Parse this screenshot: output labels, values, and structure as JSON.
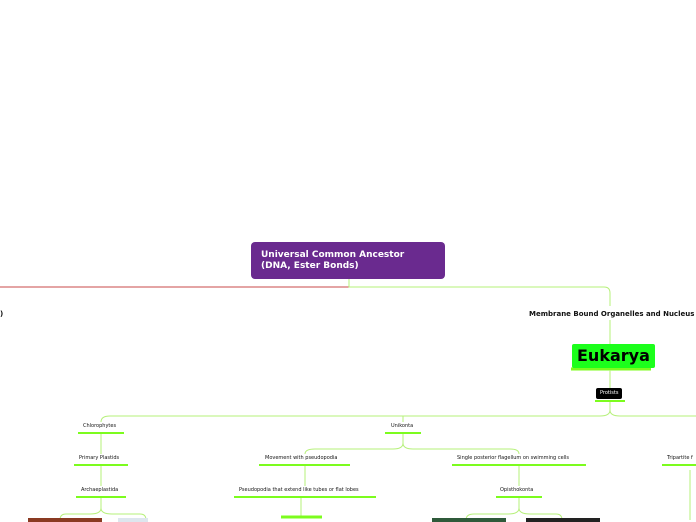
{
  "root": {
    "line1": "Universal Common Ancestor",
    "line2": "(DNA, Ester Bonds)"
  },
  "left_branch": {
    "label": ")"
  },
  "right_branch": {
    "label": "Membrane Bound Organelles and Nucleus"
  },
  "eukarya": "Eukarya",
  "protists": "Protists",
  "nodes": {
    "chlorophytes": "Chlorophytes",
    "primary_plastids": "Primary Plastids",
    "archaeplastida": "Archaeplastida",
    "unikonta": "Unikonta",
    "movement": "Movement with pseudopodia",
    "pseudopodia_tubes": "Pseudopodia that extend like tubes or flat lobes",
    "single_flagellum": "Single posterior flagellum on swimming cells",
    "opisthokonta": "Opisthokonta",
    "tripartite": "Tripartite f"
  },
  "colors": {
    "root": "#6a2a8f",
    "eukarya": "#1cff1c",
    "connector_green": "#b6f07a",
    "underline_green": "#7cfc1e",
    "connector_red": "#c94a4a"
  }
}
